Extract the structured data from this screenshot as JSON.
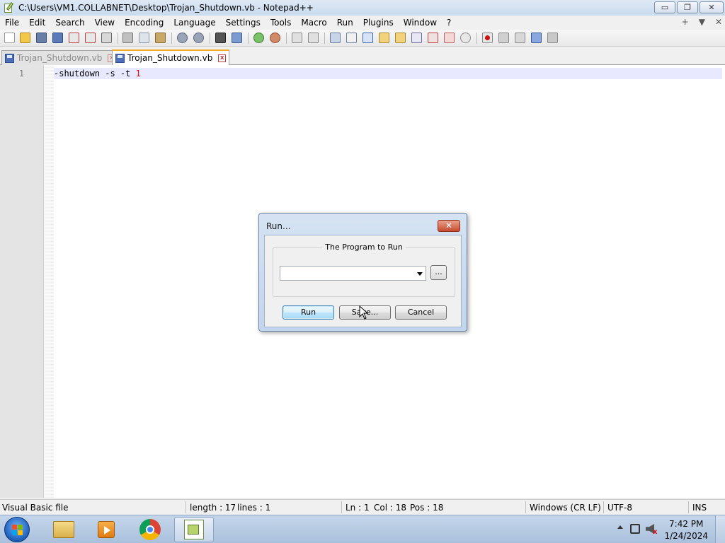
{
  "window": {
    "title": "C:\\Users\\VM1.COLLABNET\\Desktop\\Trojan_Shutdown.vb - Notepad++",
    "buttons": {
      "minimize": "▭",
      "restore": "❐",
      "close": "✕"
    }
  },
  "menu": {
    "items": [
      "File",
      "Edit",
      "Search",
      "View",
      "Encoding",
      "Language",
      "Settings",
      "Tools",
      "Macro",
      "Run",
      "Plugins",
      "Window",
      "?"
    ],
    "right": [
      "+",
      "▼",
      "✕"
    ]
  },
  "tabs": [
    {
      "label": "Trojan_Shutdown.vb",
      "active": false
    },
    {
      "label": "Trojan_Shutdown.vb",
      "active": true
    }
  ],
  "editor": {
    "line_number": "1",
    "code_text": "-shutdown -s -t ",
    "code_number": "1"
  },
  "status": {
    "language": "Visual Basic file",
    "length": "length : 17",
    "lines": "lines : 1",
    "ln": "Ln : 1",
    "col": "Col : 18",
    "pos": "Pos : 18",
    "eol": "Windows (CR LF)",
    "encoding": "UTF-8",
    "mode": "INS"
  },
  "taskbar": {
    "time": "7:42 PM",
    "date": "1/24/2024"
  },
  "dialog": {
    "title": "Run...",
    "close_glyph": "✕",
    "group_label": "The Program to Run",
    "program_value": "",
    "browse_label": "...",
    "run_label": "Run",
    "save_label": "Save...",
    "cancel_label": "Cancel"
  },
  "colors": {
    "accent_tab": "#f5a623",
    "current_line": "#e8e8ff",
    "number_literal": "#ff0000",
    "dialog_close": "#c84a2e"
  }
}
